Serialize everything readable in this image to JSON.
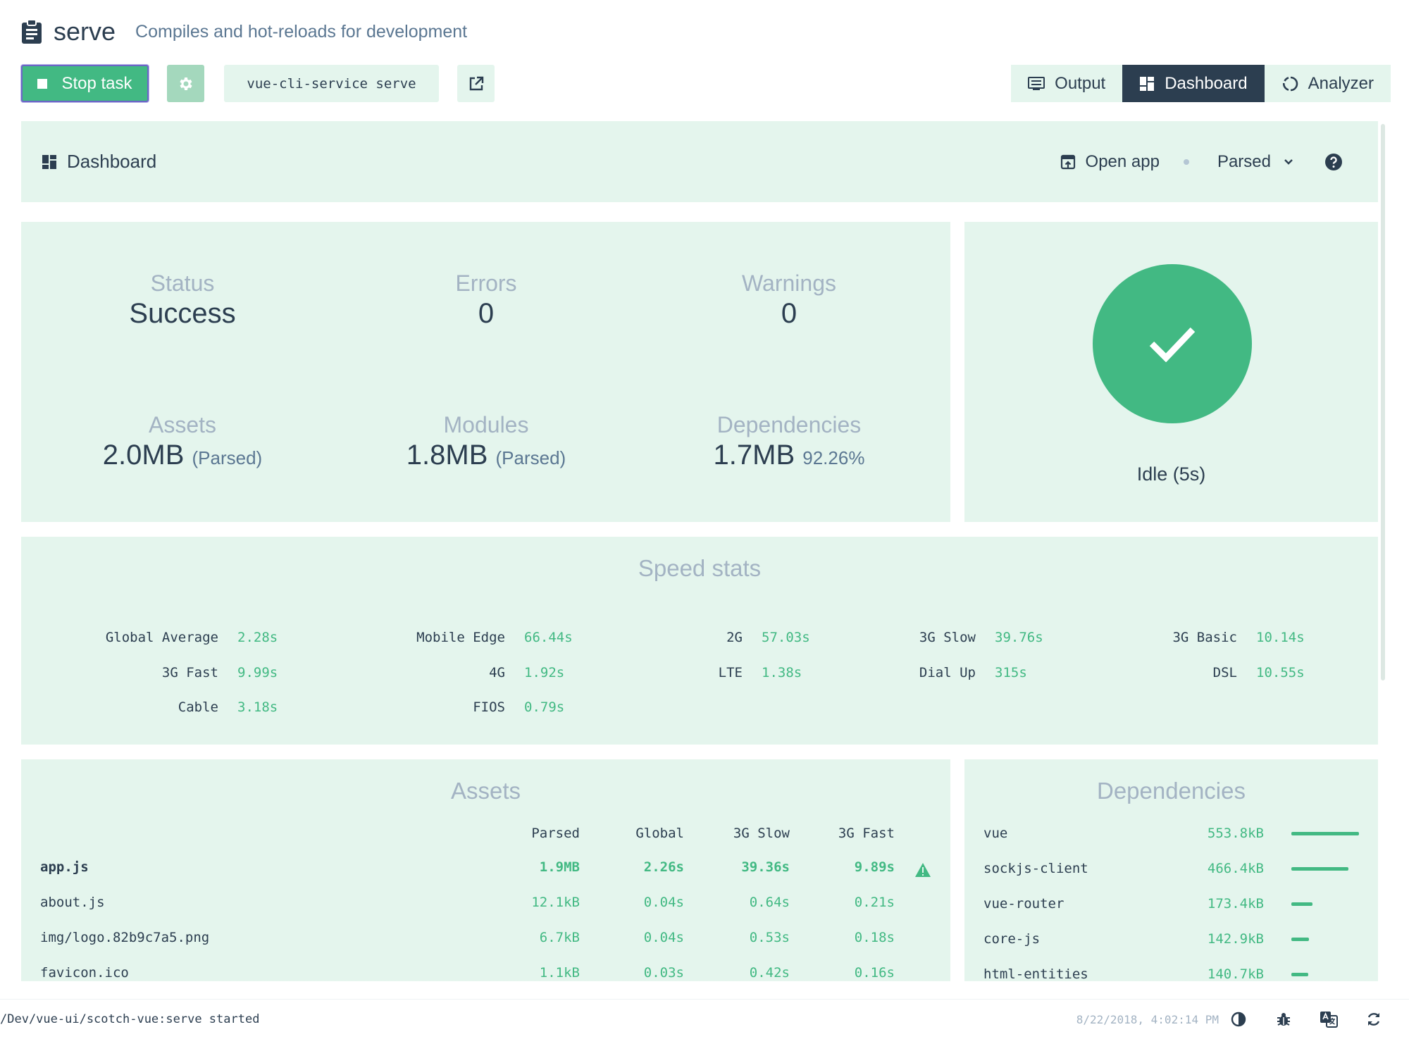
{
  "header": {
    "title": "serve",
    "description": "Compiles and hot-reloads for development"
  },
  "toolbar": {
    "stop_label": "Stop task",
    "command": "vue-cli-service serve",
    "views": [
      {
        "label": "Output",
        "icon": "output-icon",
        "active": false
      },
      {
        "label": "Dashboard",
        "icon": "dashboard-icon",
        "active": true
      },
      {
        "label": "Analyzer",
        "icon": "analyzer-icon",
        "active": false
      }
    ]
  },
  "dashboard": {
    "title": "Dashboard",
    "open_app": "Open app",
    "mode": "Parsed"
  },
  "stats": {
    "status": {
      "label": "Status",
      "value": "Success"
    },
    "errors": {
      "label": "Errors",
      "value": "0"
    },
    "warnings": {
      "label": "Warnings",
      "value": "0"
    },
    "assets": {
      "label": "Assets",
      "value": "2.0MB",
      "note": "(Parsed)"
    },
    "modules": {
      "label": "Modules",
      "value": "1.8MB",
      "note": "(Parsed)"
    },
    "dependencies": {
      "label": "Dependencies",
      "value": "1.7MB",
      "note": "92.26%"
    }
  },
  "build_status": {
    "text": "Idle (5s)",
    "color": "#42b983"
  },
  "speed": {
    "title": "Speed stats",
    "items": [
      {
        "label": "Global Average",
        "value": "2.28s"
      },
      {
        "label": "Mobile Edge",
        "value": "66.44s"
      },
      {
        "label": "2G",
        "value": "57.03s"
      },
      {
        "label": "3G Slow",
        "value": "39.76s"
      },
      {
        "label": "3G Basic",
        "value": "10.14s"
      },
      {
        "label": "3G Fast",
        "value": "9.99s"
      },
      {
        "label": "4G",
        "value": "1.92s"
      },
      {
        "label": "LTE",
        "value": "1.38s"
      },
      {
        "label": "Dial Up",
        "value": "315s"
      },
      {
        "label": "DSL",
        "value": "10.55s"
      },
      {
        "label": "Cable",
        "value": "3.18s"
      },
      {
        "label": "FIOS",
        "value": "0.79s"
      }
    ]
  },
  "assets": {
    "title": "Assets",
    "columns": [
      "Parsed",
      "Global",
      "3G Slow",
      "3G Fast"
    ],
    "rows": [
      {
        "name": "app.js",
        "parsed": "1.9MB",
        "global": "2.26s",
        "slow": "39.36s",
        "fast": "9.89s",
        "warning": true
      },
      {
        "name": "about.js",
        "parsed": "12.1kB",
        "global": "0.04s",
        "slow": "0.64s",
        "fast": "0.21s",
        "warning": false
      },
      {
        "name": "img/logo.82b9c7a5.png",
        "parsed": "6.7kB",
        "global": "0.04s",
        "slow": "0.53s",
        "fast": "0.18s",
        "warning": false
      },
      {
        "name": "favicon.ico",
        "parsed": "1.1kB",
        "global": "0.03s",
        "slow": "0.42s",
        "fast": "0.16s",
        "warning": false
      }
    ]
  },
  "dependencies": {
    "title": "Dependencies",
    "rows": [
      {
        "name": "vue",
        "size": "553.8kB",
        "ratio": 1.0
      },
      {
        "name": "sockjs-client",
        "size": "466.4kB",
        "ratio": 0.84
      },
      {
        "name": "vue-router",
        "size": "173.4kB",
        "ratio": 0.31
      },
      {
        "name": "core-js",
        "size": "142.9kB",
        "ratio": 0.26
      },
      {
        "name": "html-entities",
        "size": "140.7kB",
        "ratio": 0.25
      }
    ]
  },
  "statusbar": {
    "log": "/Dev/vue-ui/scotch-vue:serve started",
    "time": "8/22/2018, 4:02:14 PM",
    "icons": [
      "contrast-icon",
      "bug-icon",
      "translate-icon",
      "refresh-icon"
    ]
  },
  "colors": {
    "accent": "#42b983",
    "dark": "#2c3e50",
    "panel": "#e4f5ed",
    "muted": "#a3b3c3"
  }
}
